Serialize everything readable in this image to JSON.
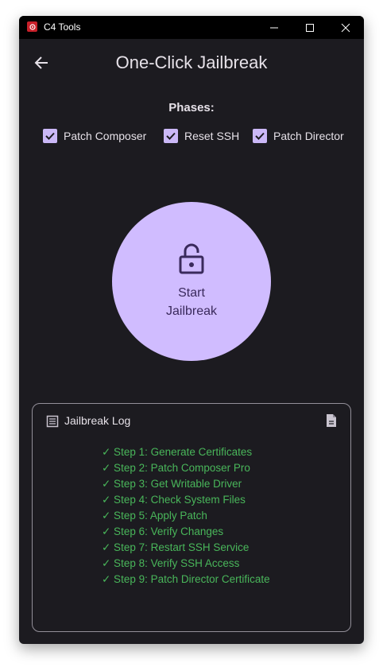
{
  "window": {
    "title": "C4 Tools",
    "controls": [
      "minimize-icon",
      "maximize-icon",
      "close-icon"
    ]
  },
  "header": {
    "back_icon": "arrow-left-icon",
    "title": "One-Click Jailbreak"
  },
  "phases": {
    "label": "Phases:",
    "items": [
      {
        "label": "Patch Composer",
        "checked": true
      },
      {
        "label": "Reset SSH",
        "checked": true
      },
      {
        "label": "Patch Director",
        "checked": true
      }
    ]
  },
  "start_button": {
    "icon": "unlock-icon",
    "label": "Start Jailbreak"
  },
  "log": {
    "title": "Jailbreak Log",
    "header_icon": "list-icon",
    "action_icon": "document-icon",
    "lines": [
      "✓ Step 1: Generate Certificates",
      "✓ Step 2: Patch Composer Pro",
      "✓ Step 3: Get Writable Driver",
      "✓ Step 4: Check System Files",
      "✓ Step 5: Apply Patch",
      "✓ Step 6: Verify Changes",
      "✓ Step 7: Restart SSH Service",
      "✓ Step 8: Verify SSH Access",
      "✓ Step 9: Patch Director Certificate"
    ]
  },
  "colors": {
    "background": "#1c1b20",
    "accent": "#d0bcff",
    "checkbox": "#cbb8f7",
    "success": "#49b65a",
    "border": "#938f99"
  }
}
